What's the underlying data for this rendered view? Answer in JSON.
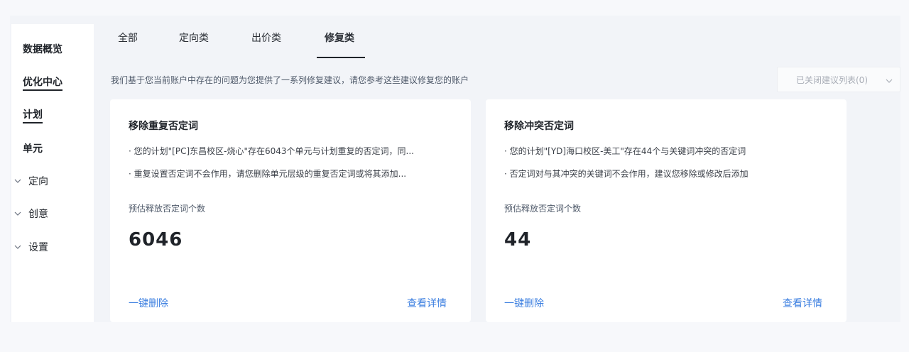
{
  "sidebar": {
    "items": [
      {
        "label": "数据概览"
      },
      {
        "label": "优化中心"
      },
      {
        "label": "计划"
      },
      {
        "label": "单元"
      },
      {
        "label": "定向"
      },
      {
        "label": "创意"
      },
      {
        "label": "设置"
      }
    ]
  },
  "tabs": [
    {
      "label": "全部"
    },
    {
      "label": "定向类"
    },
    {
      "label": "出价类"
    },
    {
      "label": "修复类"
    }
  ],
  "info_text": "我们基于您当前账户中存在的问题为您提供了一系列修复建议，请您参考这些建议修复您的账户",
  "dropdown": {
    "label": "已关闭建议列表(0)"
  },
  "cards": [
    {
      "title": "移除重复否定词",
      "bullets": [
        "· 您的计划\"[PC]东昌校区-烧心\"存在6043个单元与计划重复的否定词，同...",
        "· 重复设置否定词不会作用，请您删除单元层级的重复否定词或将其添加..."
      ],
      "metric_label": "预估释放否定词个数",
      "metric_value": "6046",
      "action_left": "一键删除",
      "action_right": "查看详情"
    },
    {
      "title": "移除冲突否定词",
      "bullets": [
        "· 您的计划\"[YD]海口校区-美工\"存在44个与关键词冲突的否定词",
        "· 否定词对与其冲突的关键词不会作用，建议您移除或修改后添加"
      ],
      "metric_label": "预估释放否定词个数",
      "metric_value": "44",
      "action_left": "一键删除",
      "action_right": "查看详情"
    }
  ],
  "icons": {
    "expand": "chevron-down-icon",
    "dropdown_caret": "chevron-down-icon"
  },
  "colors": {
    "link": "#3c7fe0",
    "text": "#1f2329"
  }
}
